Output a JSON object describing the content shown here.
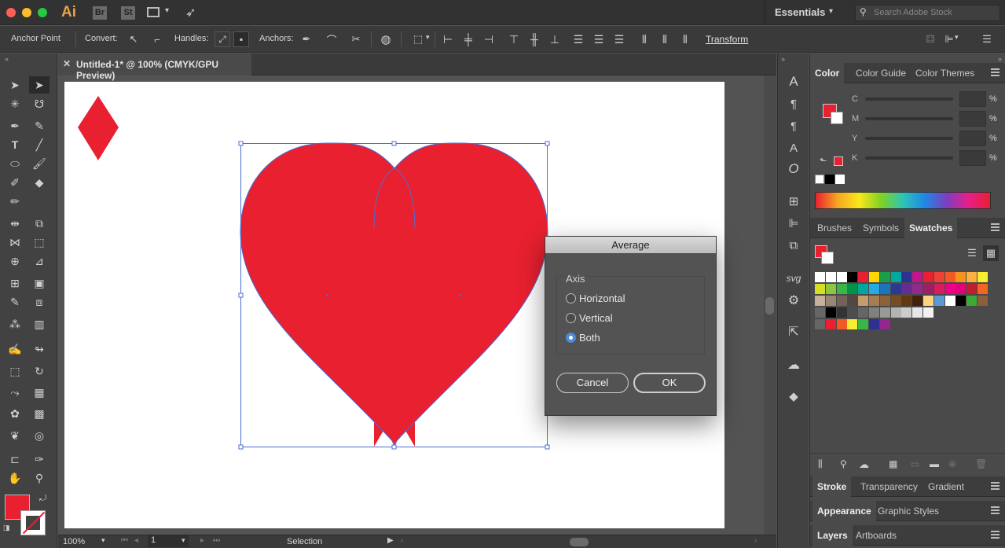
{
  "app": {
    "logo": "Ai",
    "bridge": "Br",
    "stock": "St",
    "workspace": "Essentials",
    "search_placeholder": "Search Adobe Stock"
  },
  "control_bar": {
    "mode": "Anchor Point",
    "convert_label": "Convert:",
    "handles_label": "Handles:",
    "anchors_label": "Anchors:",
    "transform_label": "Transform"
  },
  "document": {
    "tab_title": "Untitled-1* @ 100% (CMYK/GPU Preview)"
  },
  "status": {
    "zoom": "100%",
    "artboard": "1",
    "tool": "Selection"
  },
  "color_panel": {
    "tabs": [
      "Color",
      "Color Guide",
      "Color Themes"
    ],
    "channels": [
      {
        "label": "C"
      },
      {
        "label": "M"
      },
      {
        "label": "Y"
      },
      {
        "label": "K"
      }
    ],
    "unit": "%"
  },
  "swatches_panel": {
    "tabs": [
      "Brushes",
      "Symbols",
      "Swatches"
    ]
  },
  "stroke_panel": {
    "tabs": [
      "Stroke",
      "Transparency",
      "Gradient"
    ]
  },
  "appearance_panel": {
    "tabs": [
      "Appearance",
      "Graphic Styles"
    ]
  },
  "layers_panel": {
    "tabs": [
      "Layers",
      "Artboards"
    ]
  },
  "dialog": {
    "title": "Average",
    "group_label": "Axis",
    "options": [
      "Horizontal",
      "Vertical",
      "Both"
    ],
    "selected": "Both",
    "cancel": "Cancel",
    "ok": "OK"
  },
  "colors": {
    "fill": "#e8202f",
    "accent": "#4a8cd8",
    "selection": "#4a6fd8"
  }
}
